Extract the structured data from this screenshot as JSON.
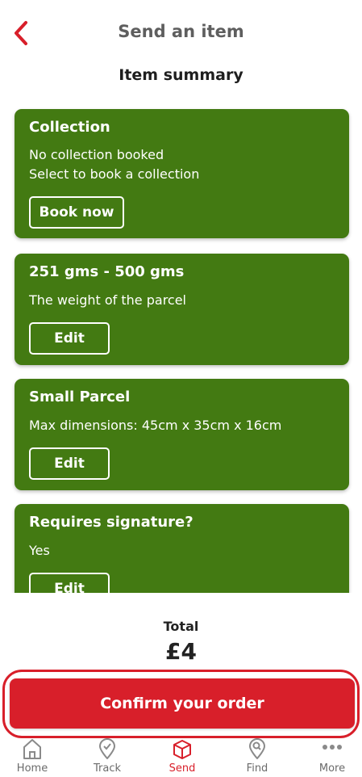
{
  "header": {
    "title": "Send an item",
    "back_icon": "chevron-left-icon"
  },
  "summary": {
    "heading": "Item summary"
  },
  "cards": [
    {
      "title": "Collection",
      "lines": [
        "No collection booked",
        "Select to book a collection"
      ],
      "button": "Book now"
    },
    {
      "title": "251 gms - 500 gms",
      "lines": [
        "The weight of the parcel"
      ],
      "button": "Edit"
    },
    {
      "title": "Small Parcel",
      "lines": [
        "Max dimensions: 45cm x 35cm x 16cm"
      ],
      "button": "Edit"
    },
    {
      "title": "Requires signature?",
      "lines": [
        "Yes"
      ],
      "button": "Edit"
    }
  ],
  "total": {
    "label": "Total",
    "value": "£4"
  },
  "confirm": {
    "label": "Confirm your order"
  },
  "tabs": [
    {
      "label": "Home",
      "icon": "home-icon",
      "active": false
    },
    {
      "label": "Track",
      "icon": "track-icon",
      "active": false
    },
    {
      "label": "Send",
      "icon": "parcel-icon",
      "active": true
    },
    {
      "label": "Find",
      "icon": "find-location-icon",
      "active": false
    },
    {
      "label": "More",
      "icon": "more-dots-icon",
      "active": false
    }
  ],
  "colors": {
    "brand_red": "#d81f2a",
    "card_green": "#437a12"
  }
}
